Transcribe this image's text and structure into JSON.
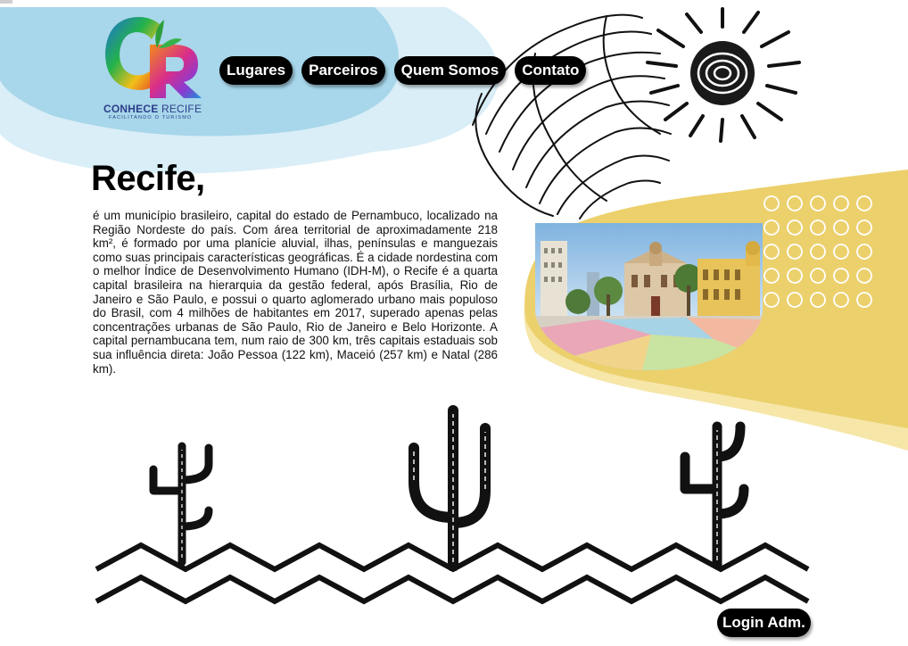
{
  "brand": {
    "name_bold": "CONHECE",
    "name_light": "RECIFE",
    "tagline": "FACILITANDO O TURISMO",
    "logo_letters": "CR"
  },
  "nav": {
    "items": [
      {
        "label": "Lugares"
      },
      {
        "label": "Parceiros"
      },
      {
        "label": "Quem Somos"
      },
      {
        "label": "Contato"
      }
    ]
  },
  "main": {
    "title": "Recife,",
    "description": "é um município brasileiro, capital do estado de Pernambuco, localizado na Região Nordeste do país. Com área territorial de aproximadamente 218 km², é formado por uma planície aluvial, ilhas, penínsulas e manguezais como suas principais características geográficas. É a cidade nordestina com o melhor Índice de Desenvolvimento Humano (IDH-M), o Recife é a quarta capital brasileira na hierarquia da gestão federal, após Brasília, Rio de Janeiro e São Paulo, e possui o quarto aglomerado urbano mais populoso do Brasil, com 4 milhões de habitantes em 2017, superado apenas pelas concentrações urbanas de São Paulo, Rio de Janeiro e Belo Horizonte. A capital pernambucana tem, num raio de 300 km, três capitais estaduais sob sua influência direta: João Pessoa (122 km), Maceió (257 km) e Natal (286 km)."
  },
  "footer": {
    "login_label": "Login Adm."
  },
  "colors": {
    "blob_blue": "#a8d6ea",
    "blob_blue_light": "#d9eef7",
    "yellow": "#ecd06c",
    "yellow_light": "#f6e6a8",
    "button_bg": "#000000",
    "button_text": "#ffffff"
  },
  "icons": [
    "sun-icon",
    "cactus-icon",
    "zigzag-ground-icon",
    "dots-pattern-icon"
  ]
}
